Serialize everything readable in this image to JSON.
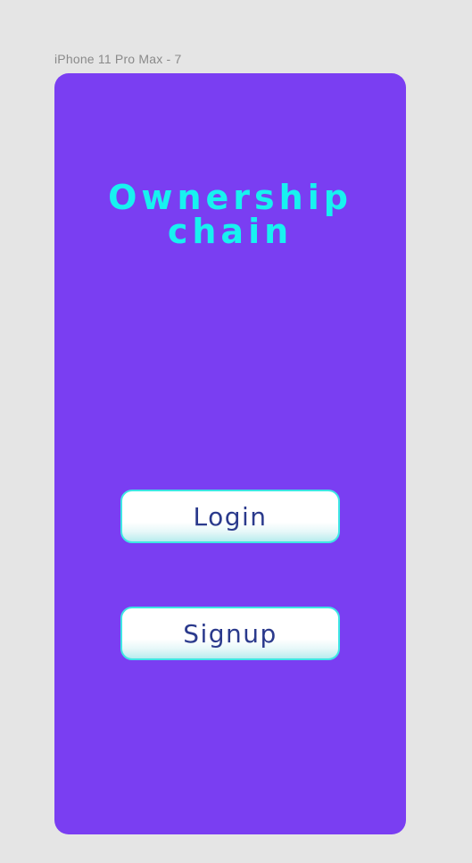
{
  "frame": {
    "label": "iPhone 11 Pro Max - 7"
  },
  "app": {
    "title_line1": "Ownership",
    "title_line2": "chain"
  },
  "buttons": {
    "login_label": "Login",
    "signup_label": "Signup"
  },
  "colors": {
    "canvas_background": "#e5e5e5",
    "screen_background": "#7a3ef2",
    "title": "#17f2f0",
    "button_text": "#2b3a8c",
    "button_border": "#3ee6e4"
  }
}
